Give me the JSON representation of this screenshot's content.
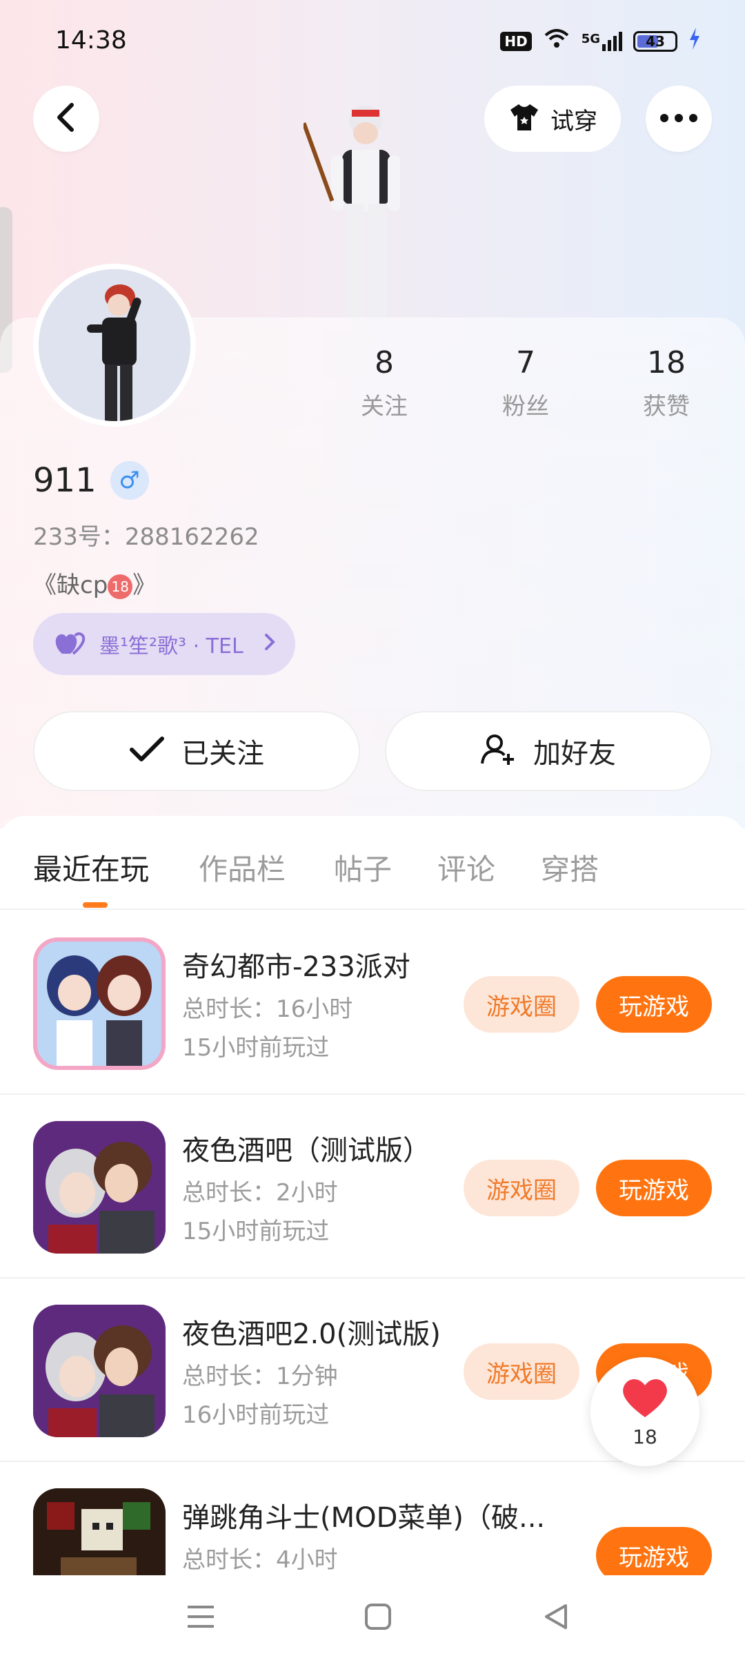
{
  "status_bar": {
    "time": "14:38",
    "hd": "HD",
    "network": "5G",
    "battery": "43"
  },
  "header": {
    "try_on_label": "试穿"
  },
  "stats": [
    {
      "num": "8",
      "label": "关注"
    },
    {
      "num": "7",
      "label": "粉丝"
    },
    {
      "num": "18",
      "label": "获赞"
    }
  ],
  "profile": {
    "name": "911",
    "gender_symbol": "♂",
    "uid": "233号：288162262",
    "bio_prefix": "《缺cp",
    "bio_badge": "18",
    "bio_suffix": "》",
    "cp_tag": "墨¹笙²歌³ · TEL"
  },
  "actions": {
    "followed": "已关注",
    "add_friend": "加好友"
  },
  "tabs": [
    "最近在玩",
    "作品栏",
    "帖子",
    "评论",
    "穿搭"
  ],
  "games": [
    {
      "title": "奇幻都市-233派对",
      "duration": "总时长：16小时",
      "last_played": "15小时前玩过",
      "circle": "游戏圈",
      "play": "玩游戏"
    },
    {
      "title": "夜色酒吧（测试版）",
      "duration": "总时长：2小时",
      "last_played": "15小时前玩过",
      "circle": "游戏圈",
      "play": "玩游戏"
    },
    {
      "title": "夜色酒吧2.0(测试版)",
      "duration": "总时长：1分钟",
      "last_played": "16小时前玩过",
      "circle": "游戏圈",
      "play": "玩游戏"
    },
    {
      "title": "弹跳角斗士(MOD菜单)（破...",
      "duration": "总时长：4小时",
      "last_played": "",
      "circle": "",
      "play": "玩游戏"
    }
  ],
  "like_fab": {
    "count": "18"
  },
  "colors": {
    "accent": "#ff7410",
    "accent_light": "#fde6d8",
    "cp_purple": "#8a6fd6"
  }
}
